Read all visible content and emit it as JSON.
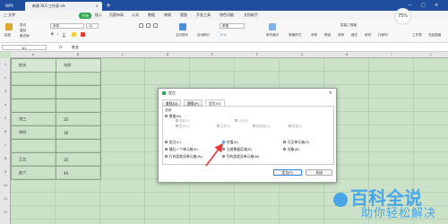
{
  "titlebar": {
    "app_tab": "WPS",
    "doc_tab": "新建 XLS 工作表.xls",
    "close_glyph": "×",
    "new_tab_glyph": "+",
    "minimize_glyph": "—",
    "maximize_glyph": "□"
  },
  "menubar": {
    "file": "三 文件",
    "items": [
      "开始",
      "插入",
      "页面布局",
      "公式",
      "数据",
      "审阅",
      "视图",
      "开发工具",
      "特色功能",
      "文档助手"
    ]
  },
  "ribbon": {
    "paste": "粘贴",
    "cut": "剪切",
    "copy": "复制",
    "format_painter": "格式刷",
    "font_name": "宋体",
    "font_size": "12",
    "merge_center": "合并居中",
    "wrap": "自动换行",
    "number_format": "常规",
    "conditional": "条件格式",
    "table_style": "表格样式",
    "sum": "求和",
    "filter": "筛选",
    "sort": "排序",
    "format": "格式",
    "fill": "填充",
    "row_col": "行和列",
    "worksheet": "工作表",
    "freeze": "冻结窗格",
    "find": "查找",
    "symbol": "符号",
    "smart_toolbox": "智能工具箱",
    "progress_percent": "75%"
  },
  "formula_bar": {
    "cell_ref": "A1",
    "fx": "fx",
    "content": "姓名"
  },
  "sheet": {
    "columns": [
      "A",
      "B",
      "C",
      "D",
      "E",
      "F",
      "G",
      "H",
      "I",
      "J"
    ],
    "rows": [
      "1",
      "2",
      "3",
      "4",
      "5",
      "6",
      "7",
      "8",
      "9",
      "10",
      "11",
      "12",
      "13"
    ],
    "table": [
      [
        "姓名",
        "年龄"
      ],
      [
        "",
        ""
      ],
      [
        "",
        ""
      ],
      [
        "",
        ""
      ],
      [
        "张三",
        "35"
      ],
      [
        "李四",
        "30"
      ],
      [
        "",
        ""
      ],
      [
        "王五",
        "35"
      ],
      [
        "赵六",
        "40"
      ]
    ]
  },
  "dialog": {
    "title": "定位",
    "close_glyph": "×",
    "tabs": [
      "查找(D)",
      "替换(P)",
      "定位(G)"
    ],
    "section_label": "选择",
    "option_data": "数据(D)",
    "sub_checks": [
      "常量(O)",
      "公式(F)",
      "数字(U)",
      "文本(X)",
      "逻辑值(G)",
      "错误(E)"
    ],
    "options_left": [
      "批注(C)",
      "最后一个单元格(S)",
      "行内容差异单元格(W)"
    ],
    "options_mid": [
      "空值(K)",
      "当前数据区域(R)",
      "列内容差异单元格(M)"
    ],
    "options_right": [
      "可见单元格(Y)",
      "对象(B)"
    ],
    "btn_locate": "定位(T)",
    "btn_close": "关闭"
  },
  "watermark": {
    "line1": "百科全说",
    "line2": "助你轻松解决"
  },
  "colors": {
    "title_bar": "#1f4e9e",
    "grid_bg": "#cbe1c8",
    "accent_green": "#2ea44f",
    "arrow": "#e53935",
    "watermark": "#4aa5e8"
  }
}
